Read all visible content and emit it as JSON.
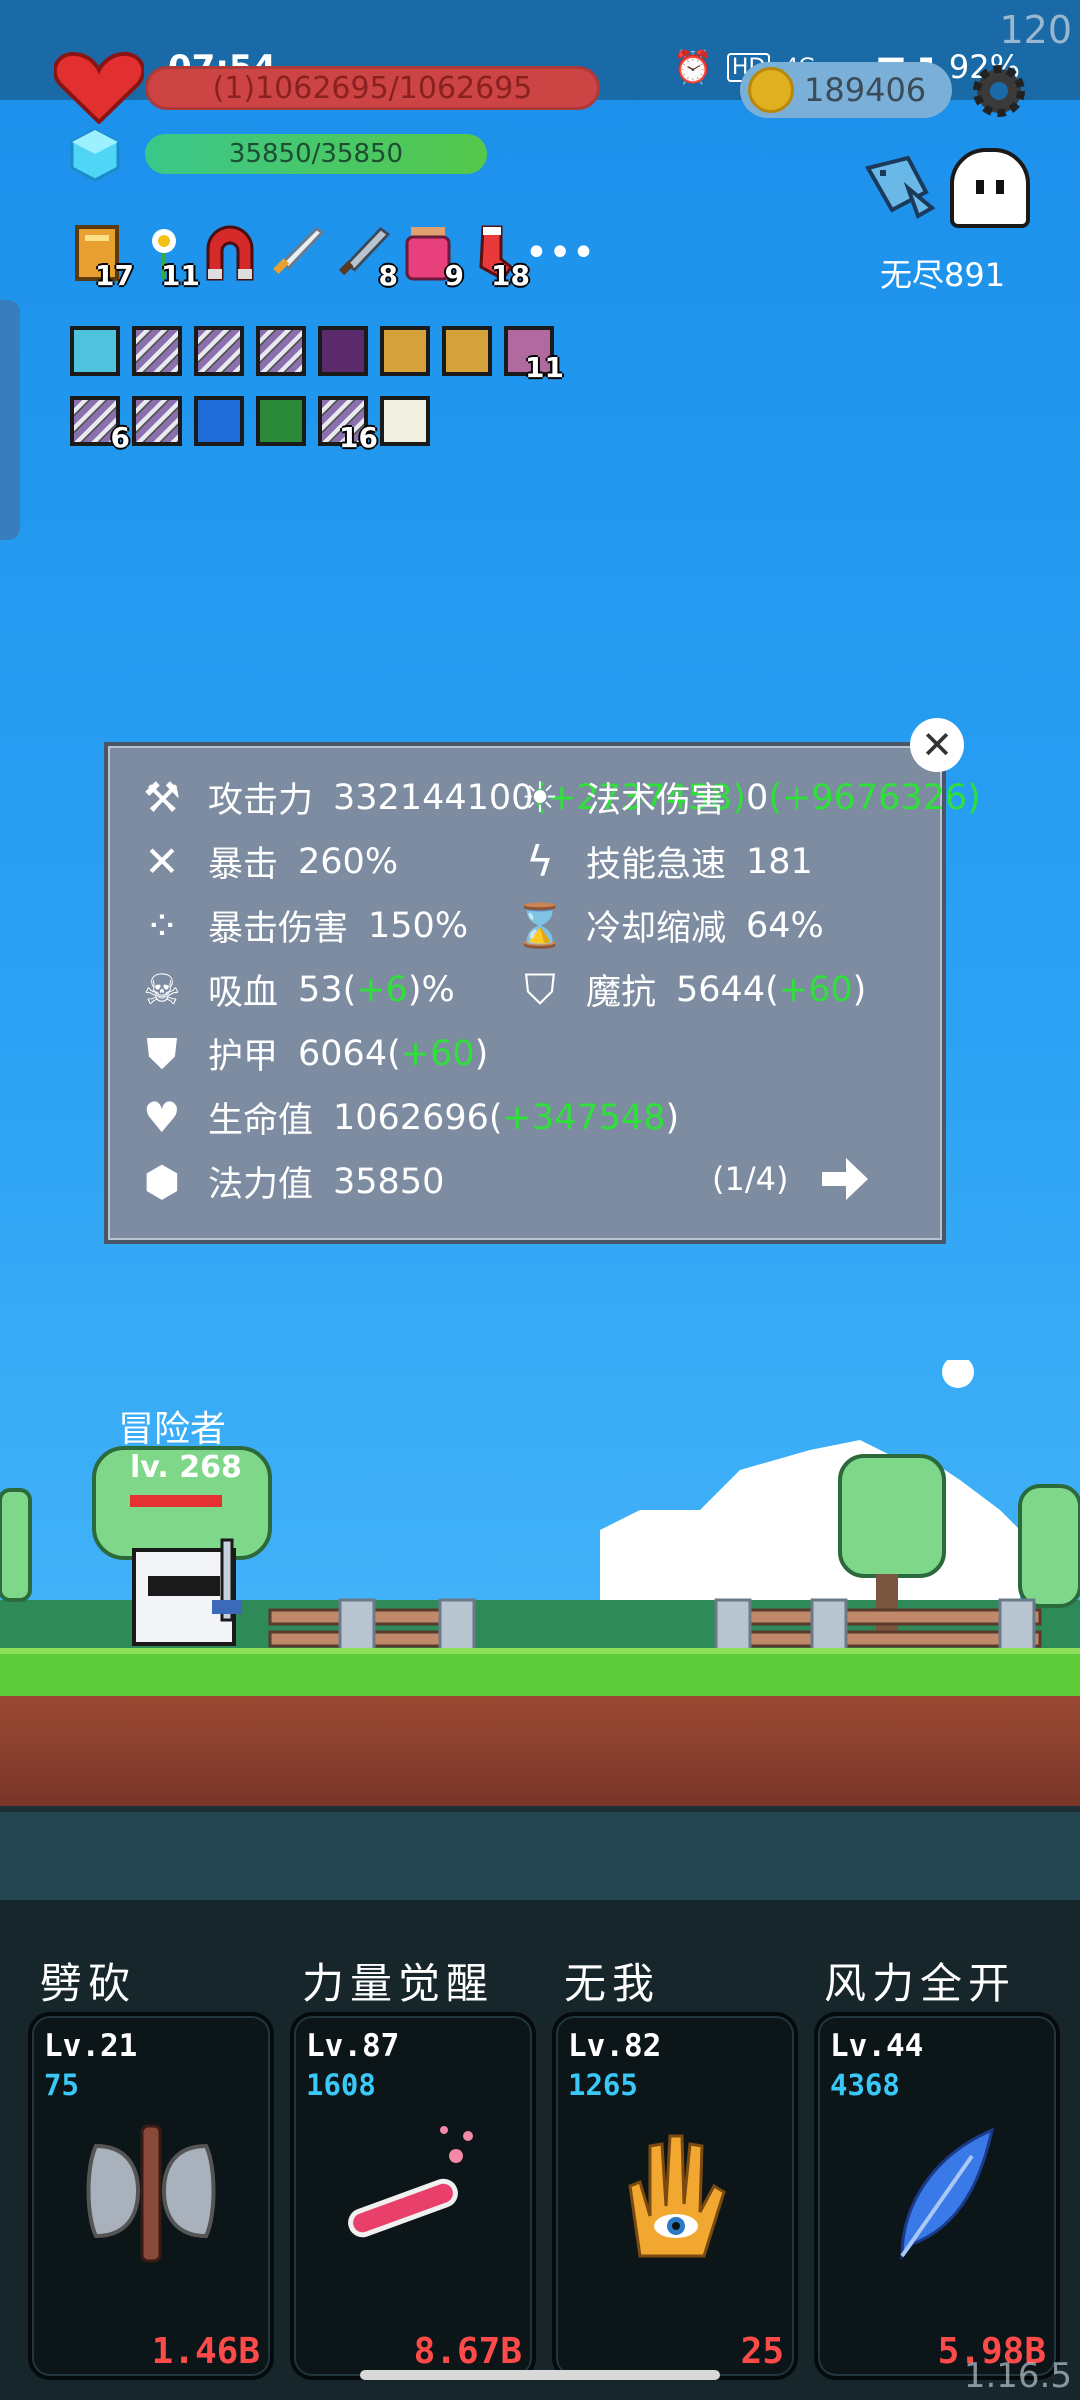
{
  "overlay": {
    "fps": "120",
    "version": "1.16.5"
  },
  "status": {
    "time": "07:54",
    "hd": "HD",
    "net": "4G",
    "battery": "92%"
  },
  "player": {
    "hp_text": "(1)1062695/1062695",
    "mp_text": "35850/35850",
    "coins": "189406",
    "endless_label": "无尽891"
  },
  "items": [
    {
      "icon": "book-icon",
      "count": "17"
    },
    {
      "icon": "flower-icon",
      "count": "11"
    },
    {
      "icon": "magnet-icon",
      "count": ""
    },
    {
      "icon": "sword-icon",
      "count": ""
    },
    {
      "icon": "blade-icon",
      "count": "8"
    },
    {
      "icon": "potion-jar-icon",
      "count": "9"
    },
    {
      "icon": "sock-icon",
      "count": "18"
    }
  ],
  "more_label": "•••",
  "slots_row1": [
    {
      "icon": "lamp-icon",
      "count": ""
    },
    {
      "icon": "blade-card-icon",
      "count": ""
    },
    {
      "icon": "blade-card-icon",
      "count": ""
    },
    {
      "icon": "blade-card-icon",
      "count": ""
    },
    {
      "icon": "demon-icon",
      "count": ""
    },
    {
      "icon": "shield-card-icon",
      "count": ""
    },
    {
      "icon": "shield-card-icon",
      "count": ""
    },
    {
      "icon": "pink-card-icon",
      "count": "11"
    }
  ],
  "slots_row2": [
    {
      "icon": "blade-card-icon",
      "count": "6"
    },
    {
      "icon": "blade-card-icon",
      "count": ""
    },
    {
      "icon": "snow-icon",
      "count": ""
    },
    {
      "icon": "green-rune-icon",
      "count": ""
    },
    {
      "icon": "blade-card-icon",
      "count": "16"
    },
    {
      "icon": "sprout-icon",
      "count": ""
    }
  ],
  "stats": {
    "attack": {
      "label": "攻击力",
      "value": "332144100",
      "bonus": "(+2737458)"
    },
    "magic": {
      "label": "法术伤害",
      "value": "0",
      "bonus": "(+9676326)"
    },
    "crit": {
      "label": "暴击",
      "value": "260%"
    },
    "haste": {
      "label": "技能急速",
      "value": "181"
    },
    "crit_dmg": {
      "label": "暴击伤害",
      "value": "150%"
    },
    "cdr": {
      "label": "冷却缩减",
      "value": "64%"
    },
    "lifesteal": {
      "label": "吸血",
      "value": "53",
      "bonus": "+6",
      "suffix": "%"
    },
    "mres": {
      "label": "魔抗",
      "value": "5644",
      "bonus": "+60"
    },
    "armor": {
      "label": "护甲",
      "value": "6064",
      "bonus": "+60"
    },
    "hp": {
      "label": "生命值",
      "value": "1062696",
      "bonus": "+347548"
    },
    "mana": {
      "label": "法力值",
      "value": "35850"
    },
    "page": "(1/4)"
  },
  "hero": {
    "name": "冒险者",
    "level": "lv. 268"
  },
  "skills": [
    {
      "title": "劈砍",
      "level": "Lv.21",
      "mana": "75",
      "cost": "1.46B",
      "icon": "axe-icon"
    },
    {
      "title": "力量觉醒",
      "level": "Lv.87",
      "mana": "1608",
      "cost": "8.67B",
      "icon": "potion-icon"
    },
    {
      "title": "无我",
      "level": "Lv.82",
      "mana": "1265",
      "cost": "25",
      "icon": "eye-hand-icon"
    },
    {
      "title": "风力全开",
      "level": "Lv.44",
      "mana": "4368",
      "cost": "5.98B",
      "icon": "feather-icon"
    }
  ],
  "colors": {
    "accent_green": "#2fe03a",
    "cost_red": "#ff4a4a",
    "mana_blue": "#3ac8f8"
  }
}
